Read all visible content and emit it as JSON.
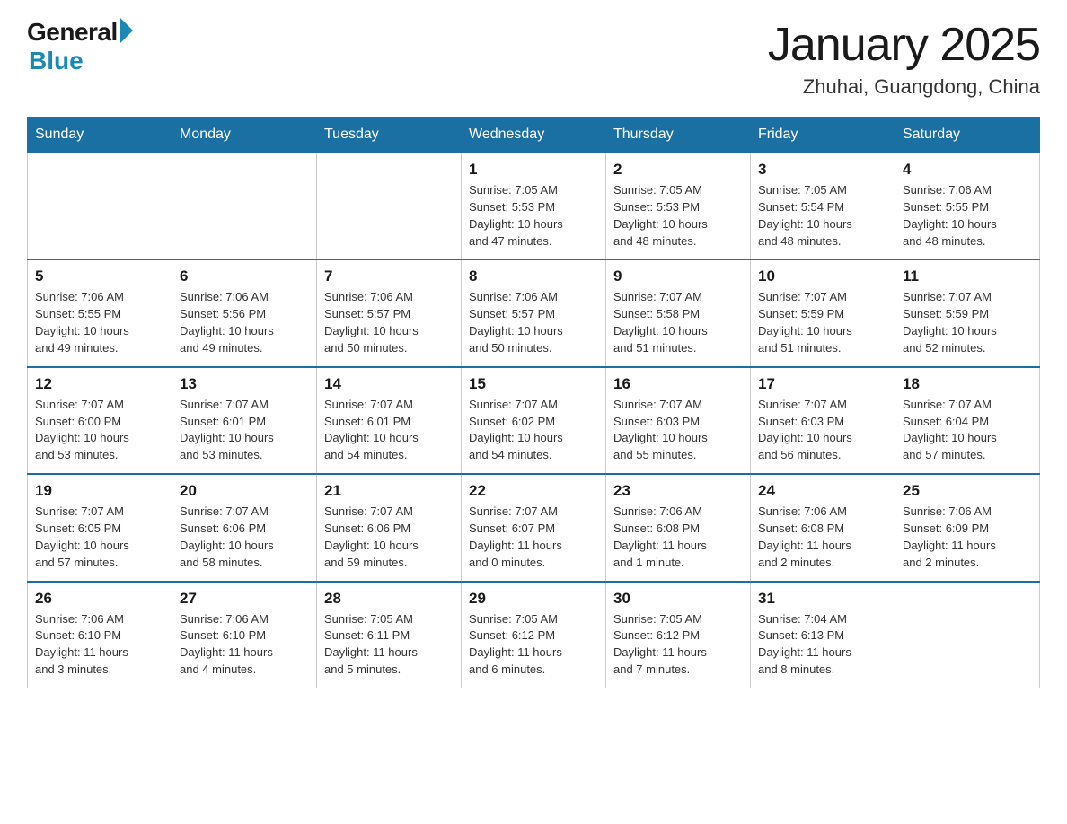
{
  "header": {
    "logo_general": "General",
    "logo_blue": "Blue",
    "month_title": "January 2025",
    "subtitle": "Zhuhai, Guangdong, China"
  },
  "days_of_week": [
    "Sunday",
    "Monday",
    "Tuesday",
    "Wednesday",
    "Thursday",
    "Friday",
    "Saturday"
  ],
  "weeks": [
    [
      {
        "day": "",
        "info": ""
      },
      {
        "day": "",
        "info": ""
      },
      {
        "day": "",
        "info": ""
      },
      {
        "day": "1",
        "info": "Sunrise: 7:05 AM\nSunset: 5:53 PM\nDaylight: 10 hours\nand 47 minutes."
      },
      {
        "day": "2",
        "info": "Sunrise: 7:05 AM\nSunset: 5:53 PM\nDaylight: 10 hours\nand 48 minutes."
      },
      {
        "day": "3",
        "info": "Sunrise: 7:05 AM\nSunset: 5:54 PM\nDaylight: 10 hours\nand 48 minutes."
      },
      {
        "day": "4",
        "info": "Sunrise: 7:06 AM\nSunset: 5:55 PM\nDaylight: 10 hours\nand 48 minutes."
      }
    ],
    [
      {
        "day": "5",
        "info": "Sunrise: 7:06 AM\nSunset: 5:55 PM\nDaylight: 10 hours\nand 49 minutes."
      },
      {
        "day": "6",
        "info": "Sunrise: 7:06 AM\nSunset: 5:56 PM\nDaylight: 10 hours\nand 49 minutes."
      },
      {
        "day": "7",
        "info": "Sunrise: 7:06 AM\nSunset: 5:57 PM\nDaylight: 10 hours\nand 50 minutes."
      },
      {
        "day": "8",
        "info": "Sunrise: 7:06 AM\nSunset: 5:57 PM\nDaylight: 10 hours\nand 50 minutes."
      },
      {
        "day": "9",
        "info": "Sunrise: 7:07 AM\nSunset: 5:58 PM\nDaylight: 10 hours\nand 51 minutes."
      },
      {
        "day": "10",
        "info": "Sunrise: 7:07 AM\nSunset: 5:59 PM\nDaylight: 10 hours\nand 51 minutes."
      },
      {
        "day": "11",
        "info": "Sunrise: 7:07 AM\nSunset: 5:59 PM\nDaylight: 10 hours\nand 52 minutes."
      }
    ],
    [
      {
        "day": "12",
        "info": "Sunrise: 7:07 AM\nSunset: 6:00 PM\nDaylight: 10 hours\nand 53 minutes."
      },
      {
        "day": "13",
        "info": "Sunrise: 7:07 AM\nSunset: 6:01 PM\nDaylight: 10 hours\nand 53 minutes."
      },
      {
        "day": "14",
        "info": "Sunrise: 7:07 AM\nSunset: 6:01 PM\nDaylight: 10 hours\nand 54 minutes."
      },
      {
        "day": "15",
        "info": "Sunrise: 7:07 AM\nSunset: 6:02 PM\nDaylight: 10 hours\nand 54 minutes."
      },
      {
        "day": "16",
        "info": "Sunrise: 7:07 AM\nSunset: 6:03 PM\nDaylight: 10 hours\nand 55 minutes."
      },
      {
        "day": "17",
        "info": "Sunrise: 7:07 AM\nSunset: 6:03 PM\nDaylight: 10 hours\nand 56 minutes."
      },
      {
        "day": "18",
        "info": "Sunrise: 7:07 AM\nSunset: 6:04 PM\nDaylight: 10 hours\nand 57 minutes."
      }
    ],
    [
      {
        "day": "19",
        "info": "Sunrise: 7:07 AM\nSunset: 6:05 PM\nDaylight: 10 hours\nand 57 minutes."
      },
      {
        "day": "20",
        "info": "Sunrise: 7:07 AM\nSunset: 6:06 PM\nDaylight: 10 hours\nand 58 minutes."
      },
      {
        "day": "21",
        "info": "Sunrise: 7:07 AM\nSunset: 6:06 PM\nDaylight: 10 hours\nand 59 minutes."
      },
      {
        "day": "22",
        "info": "Sunrise: 7:07 AM\nSunset: 6:07 PM\nDaylight: 11 hours\nand 0 minutes."
      },
      {
        "day": "23",
        "info": "Sunrise: 7:06 AM\nSunset: 6:08 PM\nDaylight: 11 hours\nand 1 minute."
      },
      {
        "day": "24",
        "info": "Sunrise: 7:06 AM\nSunset: 6:08 PM\nDaylight: 11 hours\nand 2 minutes."
      },
      {
        "day": "25",
        "info": "Sunrise: 7:06 AM\nSunset: 6:09 PM\nDaylight: 11 hours\nand 2 minutes."
      }
    ],
    [
      {
        "day": "26",
        "info": "Sunrise: 7:06 AM\nSunset: 6:10 PM\nDaylight: 11 hours\nand 3 minutes."
      },
      {
        "day": "27",
        "info": "Sunrise: 7:06 AM\nSunset: 6:10 PM\nDaylight: 11 hours\nand 4 minutes."
      },
      {
        "day": "28",
        "info": "Sunrise: 7:05 AM\nSunset: 6:11 PM\nDaylight: 11 hours\nand 5 minutes."
      },
      {
        "day": "29",
        "info": "Sunrise: 7:05 AM\nSunset: 6:12 PM\nDaylight: 11 hours\nand 6 minutes."
      },
      {
        "day": "30",
        "info": "Sunrise: 7:05 AM\nSunset: 6:12 PM\nDaylight: 11 hours\nand 7 minutes."
      },
      {
        "day": "31",
        "info": "Sunrise: 7:04 AM\nSunset: 6:13 PM\nDaylight: 11 hours\nand 8 minutes."
      },
      {
        "day": "",
        "info": ""
      }
    ]
  ]
}
